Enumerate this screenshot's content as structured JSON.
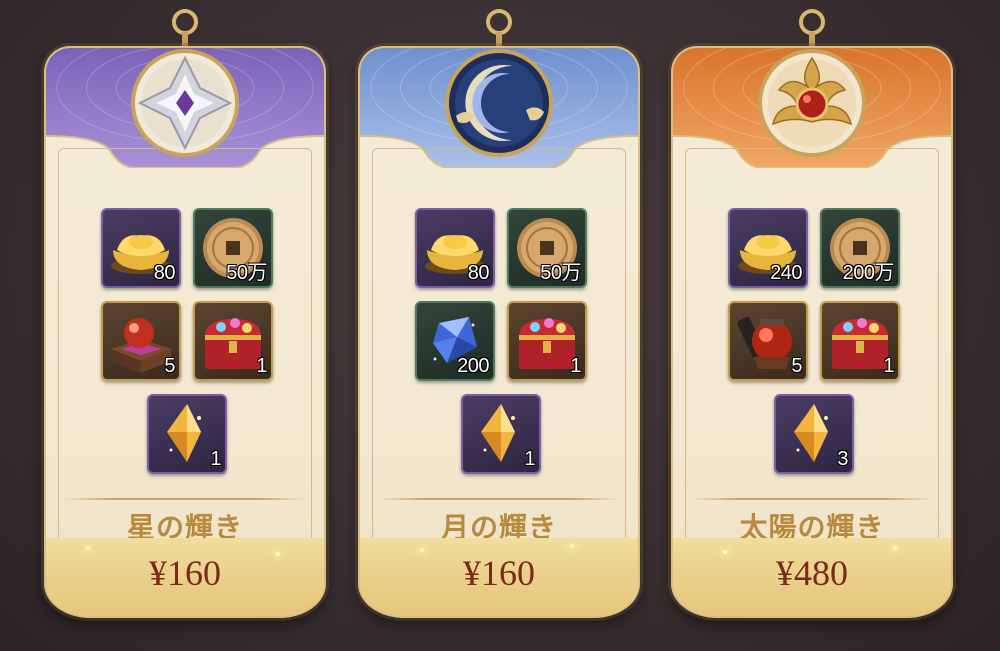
{
  "packs": [
    {
      "id": "star",
      "name": "星の輝き",
      "price": "¥160",
      "banner_color": "#8a72c4",
      "emblem": "silver-star-emblem-icon",
      "items": [
        {
          "icon": "gold-ingot-icon",
          "qty": "80",
          "frame": "purple"
        },
        {
          "icon": "bronze-coin-icon",
          "qty": "50万",
          "frame": "green"
        },
        {
          "icon": "red-orb-chest-icon",
          "qty": "5",
          "frame": "gold"
        },
        {
          "icon": "treasure-chest-icon",
          "qty": "1",
          "frame": "gold"
        },
        {
          "icon": "gold-star-crystal-icon",
          "qty": "1",
          "frame": "purple"
        }
      ]
    },
    {
      "id": "moon",
      "name": "月の輝き",
      "price": "¥160",
      "banner_color": "#7f9fd0",
      "emblem": "crescent-moon-emblem-icon",
      "items": [
        {
          "icon": "gold-ingot-icon",
          "qty": "80",
          "frame": "purple"
        },
        {
          "icon": "bronze-coin-icon",
          "qty": "50万",
          "frame": "green"
        },
        {
          "icon": "blue-gem-icon",
          "qty": "200",
          "frame": "green"
        },
        {
          "icon": "treasure-chest-icon",
          "qty": "1",
          "frame": "gold"
        },
        {
          "icon": "gold-star-crystal-icon",
          "qty": "1",
          "frame": "purple"
        }
      ]
    },
    {
      "id": "sun",
      "name": "太陽の輝き",
      "price": "¥480",
      "banner_color": "#e08a45",
      "emblem": "sun-flame-emblem-icon",
      "items": [
        {
          "icon": "gold-ingot-icon",
          "qty": "240",
          "frame": "purple"
        },
        {
          "icon": "bronze-coin-icon",
          "qty": "200万",
          "frame": "green"
        },
        {
          "icon": "red-lantern-orb-icon",
          "qty": "5",
          "frame": "gold"
        },
        {
          "icon": "treasure-chest-icon",
          "qty": "1",
          "frame": "gold"
        },
        {
          "icon": "gold-star-crystal-icon",
          "qty": "3",
          "frame": "purple"
        }
      ]
    }
  ]
}
